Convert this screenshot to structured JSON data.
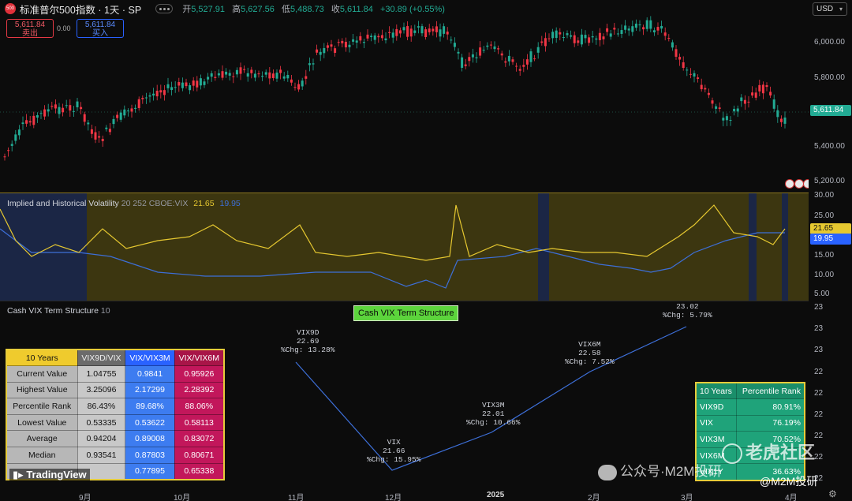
{
  "header": {
    "logo_text": "500",
    "symbol_title": "标准普尔500指数 · 1天 · SP",
    "open_label": "开",
    "open_value": "5,527.91",
    "high_label": "高",
    "high_value": "5,627.56",
    "low_label": "低",
    "low_value": "5,488.73",
    "close_label": "收",
    "close_value": "5,611.84",
    "change": "+30.89 (+0.55%)",
    "sell_price": "5,611.84",
    "sell_label": "卖出",
    "spread": "0.00",
    "buy_price": "5,611.84",
    "buy_label": "买入",
    "currency": "USD"
  },
  "price_axis": {
    "ticks": [
      "6,000.00",
      "5,800.00",
      "5,400.00",
      "5,200.00"
    ],
    "last_price": "5,611.84",
    "last_price_color": "#22ab94"
  },
  "vol_panel": {
    "title": "Implied and Historical Volatility",
    "params": "20 252 CBOE:VIX",
    "implied_value": "21.65",
    "historical_value": "19.95",
    "implied_color": "#e6c830",
    "historical_color": "#3d6fd8",
    "axis_ticks": [
      "30.00",
      "25.00",
      "20.00",
      "15.00",
      "10.00",
      "5.00"
    ]
  },
  "term_panel": {
    "title": "Cash VIX Term Structure",
    "param": "10",
    "chart_label": "Cash VIX Term Structure",
    "axis_ticks": [
      "23",
      "23",
      "23",
      "22",
      "22",
      "22",
      "22",
      "22",
      "22"
    ],
    "points": [
      {
        "name": "VIX9D",
        "value": "22.69",
        "chg": "%Chg: 13.28%"
      },
      {
        "name": "VIX",
        "value": "21.66",
        "chg": "%Chg: 15.95%"
      },
      {
        "name": "VIX3M",
        "value": "22.01",
        "chg": "%Chg: 10.66%"
      },
      {
        "name": "VIX6M",
        "value": "22.58",
        "chg": "%Chg: 7.52%"
      },
      {
        "name": "",
        "value": "23.02",
        "chg": "%Chg: 5.79%"
      }
    ]
  },
  "left_table": {
    "headers": [
      "10 Years",
      "VIX9D/VIX",
      "VIX/VIX3M",
      "VIX/VIX6M"
    ],
    "rows": [
      [
        "Current Value",
        "1.04755",
        "0.9841",
        "0.95926"
      ],
      [
        "Highest Value",
        "3.25096",
        "2.17299",
        "2.28392"
      ],
      [
        "Percentile Rank",
        "86.43%",
        "89.68%",
        "88.06%"
      ],
      [
        "Lowest Value",
        "0.53335",
        "0.53622",
        "0.58113"
      ],
      [
        "Average",
        "0.94204",
        "0.89008",
        "0.83072"
      ],
      [
        "Median",
        "0.93541",
        "0.87803",
        "0.80671"
      ],
      [
        "",
        "",
        "0.77895",
        "0.65338"
      ]
    ]
  },
  "right_table": {
    "headers": [
      "10 Years",
      "Percentile Rank"
    ],
    "rows": [
      [
        "VIX9D",
        "80.91%"
      ],
      [
        "VIX",
        "76.19%"
      ],
      [
        "VIX3M",
        "70.52%"
      ],
      [
        "VIX6M",
        ""
      ],
      [
        "VIX1Y",
        "36.63%"
      ]
    ]
  },
  "x_axis": {
    "ticks": [
      "9月",
      "10月",
      "11月",
      "12月",
      "2025",
      "2月",
      "3月",
      "4月"
    ]
  },
  "branding": {
    "tradingview": "TradingView",
    "wechat": "公众号·M2M投研",
    "tiger": "老虎社区",
    "handle": "@M2M投研"
  }
}
